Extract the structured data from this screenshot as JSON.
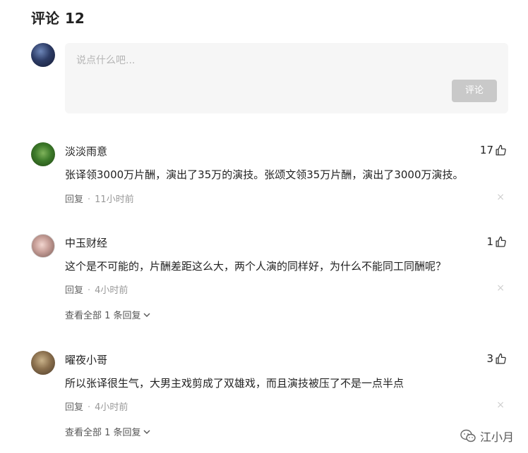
{
  "header": {
    "title": "评论",
    "count": "12"
  },
  "composer": {
    "placeholder": "说点什么吧...",
    "submit_label": "评论"
  },
  "comments": [
    {
      "name": "淡淡雨意",
      "likes": "17",
      "text": "张译领3000万片酬，演出了35万的演技。张颂文领35万片酬，演出了3000万演技。",
      "reply_label": "回复",
      "time": "11小时前",
      "close": "×"
    },
    {
      "name": "中玉财经",
      "likes": "1",
      "text": "这个是不可能的，片酬差距这么大，两个人演的同样好，为什么不能同工同酬呢？",
      "reply_label": "回复",
      "time": "4小时前",
      "close": "×",
      "view_replies": "查看全部 1 条回复"
    },
    {
      "name": "曜夜小哥",
      "likes": "3",
      "text": "所以张译很生气，大男主戏剪成了双雄戏，而且演技被压了不是一点半点",
      "reply_label": "回复",
      "time": "4小时前",
      "close": "×",
      "view_replies": "查看全部 1 条回复"
    }
  ],
  "watermark": {
    "label": "江小月"
  },
  "colors": {
    "input_bg": "#f6f6f6",
    "button_disabled": "#c9c9c9",
    "text": "#222222",
    "meta": "#999999"
  }
}
